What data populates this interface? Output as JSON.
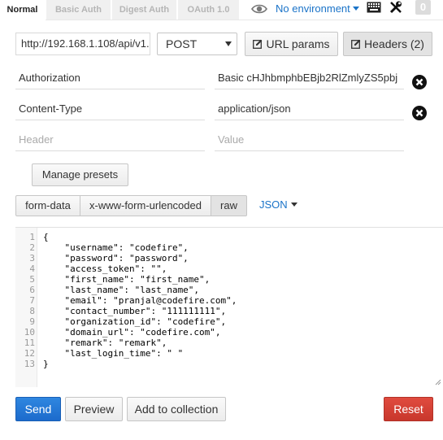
{
  "tabs": [
    "Normal",
    "Basic Auth",
    "Digest Auth",
    "OAuth 1.0"
  ],
  "environment": "No environment",
  "badge_count": "0",
  "url": "http://192.168.1.108/api/v1.",
  "method": "POST",
  "url_params_label": "URL params",
  "headers_label": "Headers (2)",
  "headers": [
    {
      "key": "Authorization",
      "value": "Basic cHJhbmphbEBjb2RlZmlyZS5pbj"
    },
    {
      "key": "Content-Type",
      "value": "application/json"
    }
  ],
  "header_placeholder": {
    "key": "Header",
    "value": "Value"
  },
  "manage_presets": "Manage presets",
  "body_modes": [
    "form-data",
    "x-www-form-urlencoded",
    "raw"
  ],
  "body_mode_selected": "raw",
  "raw_format": "JSON",
  "line_numbers": [
    "1",
    "2",
    "3",
    "4",
    "5",
    "6",
    "7",
    "8",
    "9",
    "10",
    "11",
    "12",
    "13"
  ],
  "code_lines": [
    "{",
    "    \"username\": \"codefire\",",
    "    \"password\": \"password\",",
    "    \"access_token\": \"\",",
    "    \"first_name\": \"first_name\",",
    "    \"last_name\": \"last_name\",",
    "    \"email\": \"pranjal@codefire.com\",",
    "    \"contact_number\": \"111111111\",",
    "    \"organization_id\": \"codefire\",",
    "    \"domain_url\": \"codefire.com\",",
    "    \"remark\": \"remark\",",
    "    \"last_login_time\": \" \"",
    "}"
  ],
  "actions": {
    "send": "Send",
    "preview": "Preview",
    "add": "Add to collection",
    "reset": "Reset"
  },
  "colors": {
    "accent": "#1a73c8",
    "send": "#1c6bcc",
    "reset": "#c8372c",
    "delete": "#111111"
  }
}
